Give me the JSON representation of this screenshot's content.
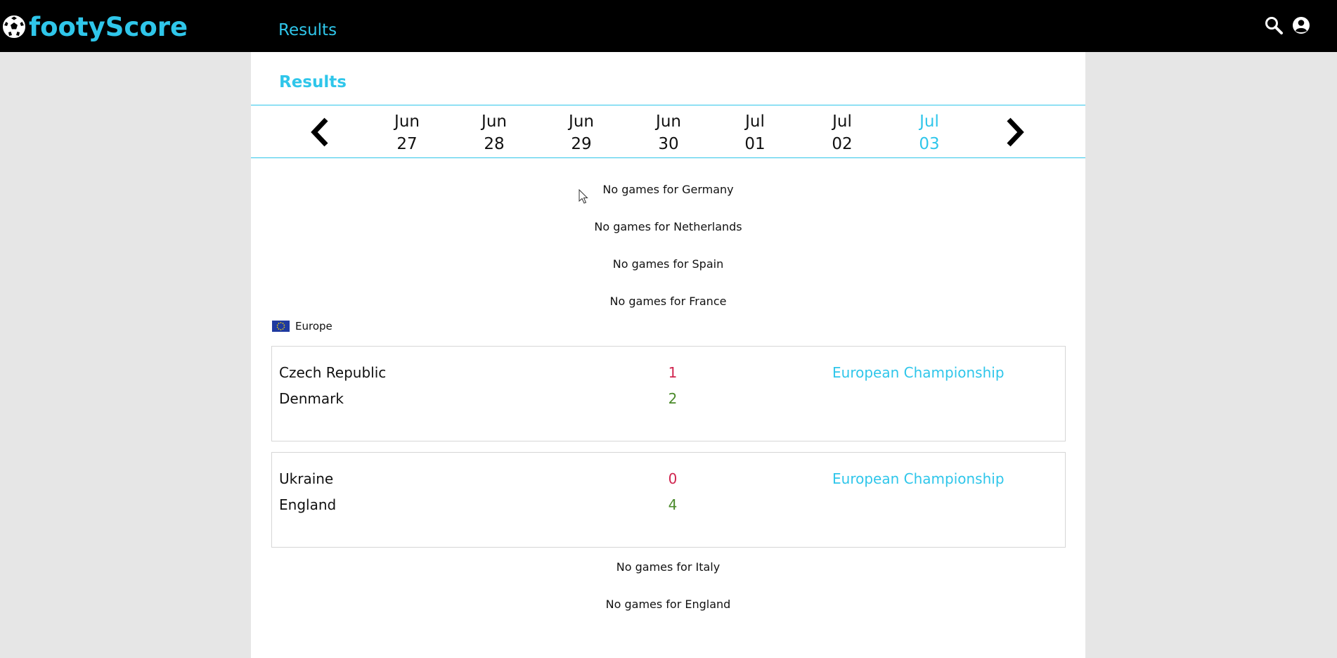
{
  "header": {
    "brand": "footyScore",
    "nav_results": "Results",
    "icons": [
      "soccer-ball-icon",
      "search-icon",
      "user-circle-icon"
    ]
  },
  "page": {
    "title": "Results"
  },
  "dates": [
    {
      "month": "Jun",
      "day": "27",
      "active": false
    },
    {
      "month": "Jun",
      "day": "28",
      "active": false
    },
    {
      "month": "Jun",
      "day": "29",
      "active": false
    },
    {
      "month": "Jun",
      "day": "30",
      "active": false
    },
    {
      "month": "Jul",
      "day": "01",
      "active": false
    },
    {
      "month": "Jul",
      "day": "02",
      "active": false
    },
    {
      "month": "Jul",
      "day": "03",
      "active": true
    }
  ],
  "messages": {
    "germany": "No games for Germany",
    "netherlands": "No games for Netherlands",
    "spain": "No games for Spain",
    "france": "No games for France",
    "italy": "No games for Italy",
    "england": "No games for England"
  },
  "region": {
    "name": "Europe",
    "flag_icon": "eu-flag-icon"
  },
  "matches": [
    {
      "home": "Czech Republic",
      "away": "Denmark",
      "home_score": "1",
      "away_score": "2",
      "competition": "European Championship"
    },
    {
      "home": "Ukraine",
      "away": "England",
      "home_score": "0",
      "away_score": "4",
      "competition": "European Championship"
    }
  ],
  "colors": {
    "accent": "#2fc6ea",
    "topbar": "#000000",
    "background": "#e6e6e6",
    "loss_score": "#d0254f",
    "win_score": "#4a8a2a"
  }
}
